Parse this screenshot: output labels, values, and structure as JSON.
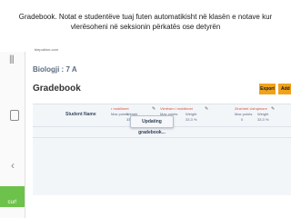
{
  "caption": {
    "line1": "Gradebook. Notat e studentëve tuaj futen automatikisht në klasën e notave kur",
    "line2": "vlerësoheni në seksionin përkatës ose detyrën"
  },
  "browser": {
    "url": "blepublon.com"
  },
  "sidebar": {
    "menu_icon": "menu-icon",
    "square_icon": "square-icon",
    "chevron_icon": "chevron-left-icon",
    "green_label": "cur!"
  },
  "page": {
    "course": "Biologji : 7 A",
    "title": "Gradebook",
    "export_label": "Export",
    "add_label": "Add N"
  },
  "table": {
    "student_header": "Student Name",
    "assignments": [
      {
        "name": "r mobilimet",
        "max_label": "Max points",
        "weight_label": "Weight",
        "max_value": "",
        "weight_value": "33.3 %"
      },
      {
        "name": "Vlerësim i mobilimet",
        "max_label": "Max points",
        "weight_label": "Weight",
        "max_value": "",
        "weight_value": "33.3 %"
      },
      {
        "name": "Zinxhiret Ushqimore",
        "max_label": "Max points",
        "weight_label": "Weight",
        "max_value": "0",
        "weight_value": "33.3 %"
      }
    ]
  },
  "toast": {
    "text": "Updating gradebook..."
  },
  "colors": {
    "accent": "#f0a21c",
    "green": "#6cc24a",
    "assignment_red": "#d4513a"
  }
}
